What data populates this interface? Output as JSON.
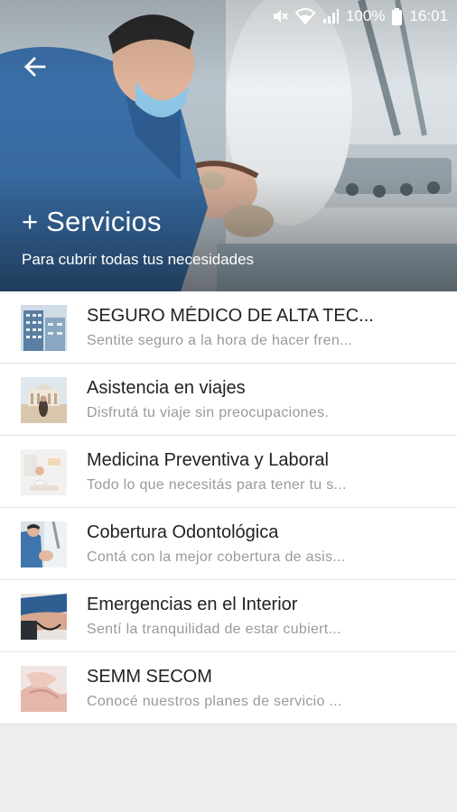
{
  "status_bar": {
    "battery": "100%",
    "time": "16:01",
    "icons": [
      "mute-icon",
      "wifi-icon",
      "signal-icon",
      "battery-icon"
    ]
  },
  "header": {
    "back_icon": "back-arrow-icon",
    "title": "+ Servicios",
    "subtitle": "Para cubrir todas tus necesidades"
  },
  "services": [
    {
      "title": "SEGURO MÉDICO DE ALTA TEC...",
      "description": "Sentite seguro a la hora de hacer fren..."
    },
    {
      "title": "Asistencia en viajes",
      "description": "Disfrutá tu viaje sin preocupaciones."
    },
    {
      "title": "Medicina Preventiva y Laboral",
      "description": "Todo lo que necesitás para tener tu s..."
    },
    {
      "title": "Cobertura Odontológica",
      "description": "Contá con la mejor cobertura de asis..."
    },
    {
      "title": "Emergencias en el Interior",
      "description": "Sentí la tranquilidad de estar cubiert..."
    },
    {
      "title": "SEMM SECOM",
      "description": "Conocé nuestros planes de servicio ..."
    }
  ]
}
